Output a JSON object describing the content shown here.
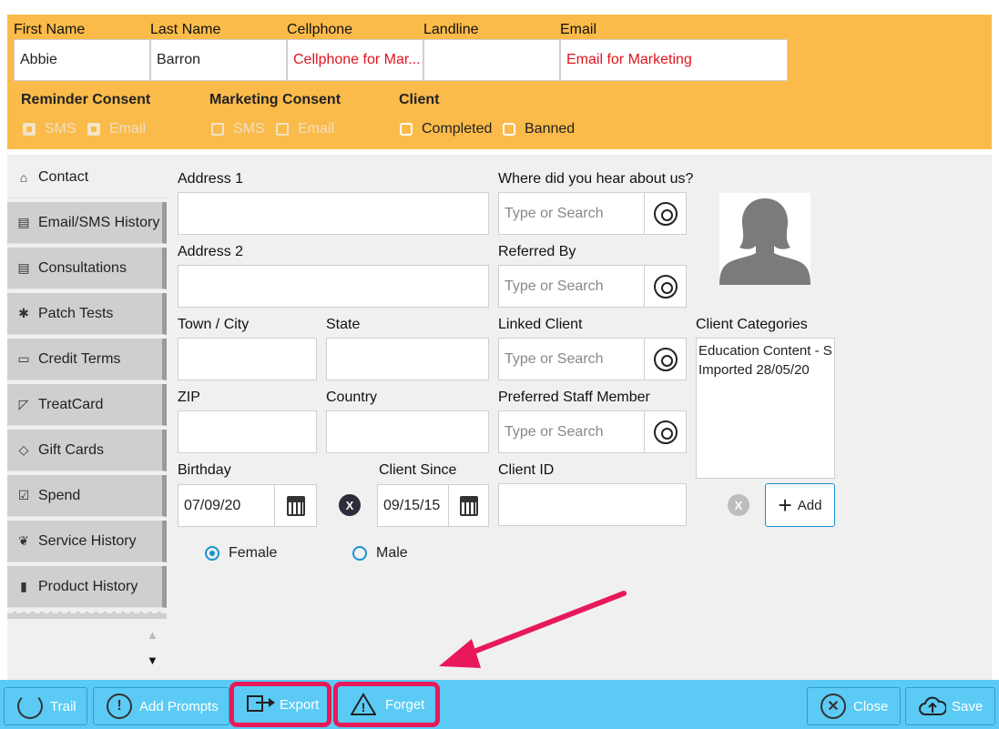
{
  "header": {
    "first_name": {
      "label": "First Name",
      "value": "Abbie"
    },
    "last_name": {
      "label": "Last Name",
      "value": "Barron"
    },
    "cellphone": {
      "label": "Cellphone",
      "value": "Cellphone for Mar..."
    },
    "landline": {
      "label": "Landline",
      "value": ""
    },
    "email": {
      "label": "Email",
      "value": "Email for Marketing"
    },
    "reminder_consent": {
      "label": "Reminder Consent",
      "sms": "SMS",
      "email": "Email"
    },
    "marketing_consent": {
      "label": "Marketing Consent",
      "sms": "SMS",
      "email": "Email"
    },
    "client": {
      "label": "Client",
      "completed": "Completed",
      "banned": "Banned"
    }
  },
  "sidebar": {
    "items": [
      {
        "label": "Contact",
        "icon": "home-icon"
      },
      {
        "label": "Email/SMS History",
        "icon": "clipboard-icon"
      },
      {
        "label": "Consultations",
        "icon": "clipboard-icon"
      },
      {
        "label": "Patch Tests",
        "icon": "bandage-icon"
      },
      {
        "label": "Credit Terms",
        "icon": "card-icon"
      },
      {
        "label": "TreatCard",
        "icon": "treatcard-icon"
      },
      {
        "label": "Gift Cards",
        "icon": "tag-icon"
      },
      {
        "label": "Spend",
        "icon": "chart-icon"
      },
      {
        "label": "Service History",
        "icon": "hands-icon"
      },
      {
        "label": "Product History",
        "icon": "bottle-icon"
      }
    ]
  },
  "form": {
    "address1": "Address 1",
    "address2": "Address 2",
    "town": "Town / City",
    "state": "State",
    "zip": "ZIP",
    "country": "Country",
    "birthday": {
      "label": "Birthday",
      "value": "07/09/20"
    },
    "client_since": {
      "label": "Client Since",
      "value": "09/15/15"
    },
    "client_id": "Client ID",
    "hear_about": "Where did you hear about us?",
    "referred_by": "Referred By",
    "linked_client": "Linked Client",
    "preferred_staff": "Preferred Staff Member",
    "search_placeholder": "Type or Search",
    "client_categories": {
      "label": "Client Categories",
      "line1": "Education Content - S",
      "line2": "Imported 28/05/20"
    },
    "add_label": "Add",
    "clear_x": "X",
    "gender": {
      "female": "Female",
      "male": "Male",
      "selected": "female"
    }
  },
  "footer": {
    "trail": "Trail",
    "add_prompts": "Add Prompts",
    "export": "Export",
    "forget": "Forget",
    "close": "Close",
    "save": "Save"
  },
  "colors": {
    "header_bg": "#fbbb4a",
    "footer_bg": "#5bcbf5",
    "highlight": "#e8195a",
    "accent": "#1793d1"
  }
}
